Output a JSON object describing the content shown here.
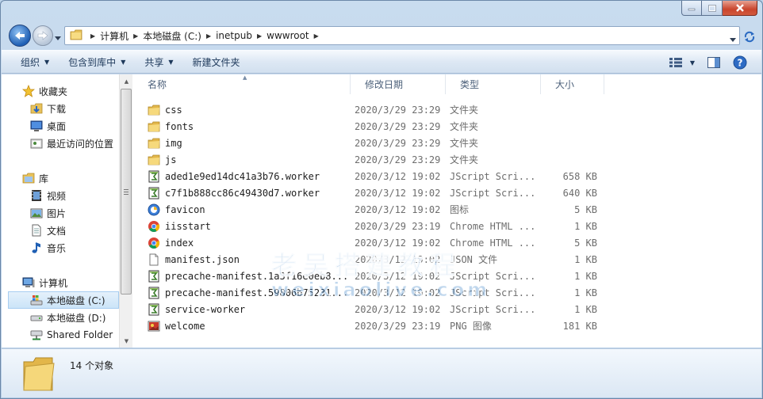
{
  "window": {
    "address": {
      "crumbs": [
        "计算机",
        "本地磁盘 (C:)",
        "inetpub",
        "wwwroot"
      ]
    }
  },
  "toolbar": {
    "organize": "组织",
    "include_in_library": "包含到库中",
    "share": "共享",
    "new_folder": "新建文件夹"
  },
  "sidebar": {
    "favorites": "收藏夹",
    "downloads": "下载",
    "desktop": "桌面",
    "recent": "最近访问的位置",
    "libraries": "库",
    "videos": "视频",
    "pictures": "图片",
    "documents": "文档",
    "music": "音乐",
    "computer": "计算机",
    "drive_c": "本地磁盘 (C:)",
    "drive_d": "本地磁盘 (D:)",
    "shared": "Shared Folder"
  },
  "columns": {
    "name": "名称",
    "date": "修改日期",
    "type": "类型",
    "size": "大小"
  },
  "files": [
    {
      "name": "css",
      "date": "2020/3/29 23:29",
      "type": "文件夹",
      "size": "",
      "icon": "folder-icon"
    },
    {
      "name": "fonts",
      "date": "2020/3/29 23:29",
      "type": "文件夹",
      "size": "",
      "icon": "folder-icon"
    },
    {
      "name": "img",
      "date": "2020/3/29 23:29",
      "type": "文件夹",
      "size": "",
      "icon": "folder-icon"
    },
    {
      "name": "js",
      "date": "2020/3/29 23:29",
      "type": "文件夹",
      "size": "",
      "icon": "folder-icon"
    },
    {
      "name": "aded1e9ed14dc41a3b76.worker",
      "date": "2020/3/12 19:02",
      "type": "JScript Scri...",
      "size": "658 KB",
      "icon": "jscript-icon"
    },
    {
      "name": "c7f1b888cc86c49430d7.worker",
      "date": "2020/3/12 19:02",
      "type": "JScript Scri...",
      "size": "640 KB",
      "icon": "jscript-icon"
    },
    {
      "name": "favicon",
      "date": "2020/3/12 19:02",
      "type": "图标",
      "size": "5 KB",
      "icon": "favicon-icon"
    },
    {
      "name": "iisstart",
      "date": "2020/3/29 23:19",
      "type": "Chrome HTML ...",
      "size": "1 KB",
      "icon": "chrome-icon"
    },
    {
      "name": "index",
      "date": "2020/3/12 19:02",
      "type": "Chrome HTML ...",
      "size": "5 KB",
      "icon": "chrome-icon"
    },
    {
      "name": "manifest.json",
      "date": "2020/3/12 19:02",
      "type": "JSON 文件",
      "size": "1 KB",
      "icon": "file-icon"
    },
    {
      "name": "precache-manifest.1a3f16e0eb8...",
      "date": "2020/3/12 19:02",
      "type": "JScript Scri...",
      "size": "1 KB",
      "icon": "jscript-icon"
    },
    {
      "name": "precache-manifest.59806b75231...",
      "date": "2020/3/12 19:02",
      "type": "JScript Scri...",
      "size": "1 KB",
      "icon": "jscript-icon"
    },
    {
      "name": "service-worker",
      "date": "2020/3/12 19:02",
      "type": "JScript Scri...",
      "size": "1 KB",
      "icon": "jscript-icon"
    },
    {
      "name": "welcome",
      "date": "2020/3/29 23:19",
      "type": "PNG 图像",
      "size": "181 KB",
      "icon": "png-icon"
    }
  ],
  "watermark": {
    "line1": "老吴搭建教程",
    "line2": "weixiaolive.com"
  },
  "status": {
    "count": "14 个对象"
  },
  "colors": {
    "accent": "#1f5fb4",
    "toolbar_text": "#1e395b",
    "selection": "#cbe4f8"
  }
}
